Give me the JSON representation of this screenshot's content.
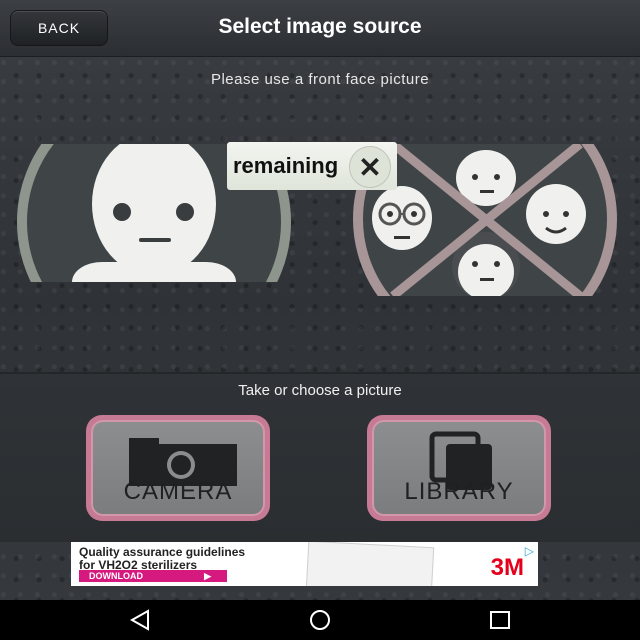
{
  "header": {
    "back_label": "BACK",
    "title": "Select image source"
  },
  "instruction": "Please use a front face picture",
  "overlay": {
    "label": "remaining",
    "close_glyph": "✕"
  },
  "subtitle": "Take or choose a picture",
  "buttons": {
    "camera_label": "CAMERA",
    "library_label": "LIBRARY"
  },
  "ad": {
    "line1": "Quality assurance guidelines",
    "line2": "for VH2O2 sterilizers",
    "cta": "DOWNLOAD",
    "brand": "3M"
  },
  "colors": {
    "accent_pink": "#c77a93",
    "good_ring": "#8e958d",
    "bad_ring": "#a79597",
    "ad_cta": "#d6197f"
  },
  "icons": [
    "camera-icon",
    "library-icon",
    "close-icon",
    "nav-back-icon",
    "nav-home-icon",
    "nav-recents-icon",
    "adchoices-icon"
  ]
}
